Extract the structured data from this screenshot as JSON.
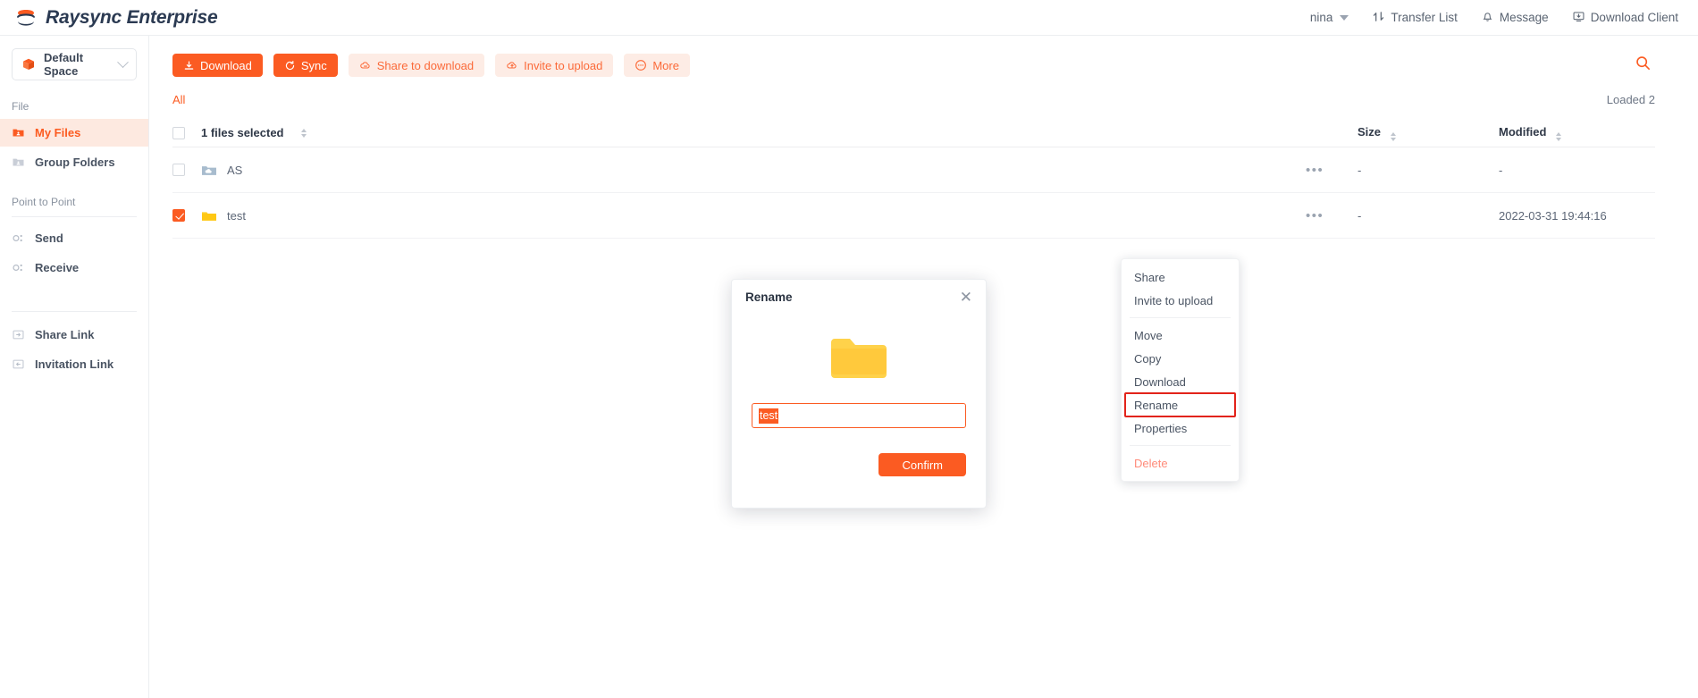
{
  "header": {
    "logo_icon": "raysync-stack-icon",
    "brand": "Raysync Enterprise",
    "user": "nina",
    "transfer_list": "Transfer List",
    "message": "Message",
    "download_client": "Download Client",
    "accent": "#fb5b22"
  },
  "sidebar": {
    "space": {
      "label": "Default Space",
      "icon": "box-icon"
    },
    "sections": [
      {
        "title": "File",
        "items": [
          {
            "label": "My Files",
            "icon": "folder-user-icon",
            "active": true
          },
          {
            "label": "Group Folders",
            "icon": "folder-group-icon",
            "active": false
          }
        ]
      },
      {
        "title": "Point to Point",
        "items": [
          {
            "label": "Send",
            "icon": "send-node-icon",
            "active": false
          },
          {
            "label": "Receive",
            "icon": "receive-node-icon",
            "active": false
          }
        ]
      },
      {
        "title": "",
        "items": [
          {
            "label": "Share Link",
            "icon": "share-link-icon",
            "active": false
          },
          {
            "label": "Invitation Link",
            "icon": "invitation-link-icon",
            "active": false
          }
        ]
      }
    ]
  },
  "toolbar": {
    "buttons": [
      {
        "label": "Download",
        "icon": "download-icon",
        "style": "solid"
      },
      {
        "label": "Sync",
        "icon": "sync-icon",
        "style": "solid"
      },
      {
        "label": "Share to download",
        "icon": "cloud-share-icon",
        "style": "soft"
      },
      {
        "label": "Invite to upload",
        "icon": "cloud-upload-icon",
        "style": "soft"
      },
      {
        "label": "More",
        "icon": "more-circle-icon",
        "style": "soft"
      }
    ],
    "search_icon": "search-icon"
  },
  "breadcrumb": {
    "all": "All",
    "loaded": "Loaded 2"
  },
  "table": {
    "headers": {
      "name": "1 files selected",
      "size": "Size",
      "modified": "Modified"
    },
    "rows": [
      {
        "name": "AS",
        "icon": "cloud-folder-icon",
        "checked": false,
        "dots": "•••",
        "size": "-",
        "modified": "-"
      },
      {
        "name": "test",
        "icon": "yellow-folder-icon",
        "checked": true,
        "dots": "•••",
        "size": "-",
        "modified": "2022-03-31 19:44:16"
      }
    ]
  },
  "context_menu": {
    "items": [
      {
        "label": "Share",
        "kind": "normal"
      },
      {
        "label": "Invite to upload",
        "kind": "normal"
      },
      {
        "label": "__sep__",
        "kind": "sep"
      },
      {
        "label": "Move",
        "kind": "normal"
      },
      {
        "label": "Copy",
        "kind": "normal"
      },
      {
        "label": "Download",
        "kind": "normal"
      },
      {
        "label": "Rename",
        "kind": "highlight"
      },
      {
        "label": "Properties",
        "kind": "normal"
      },
      {
        "label": "__sep__",
        "kind": "sep"
      },
      {
        "label": "Delete",
        "kind": "danger"
      }
    ],
    "highlight_color": "#e2231a"
  },
  "modal": {
    "title": "Rename",
    "close_icon": "close-icon",
    "folder_icon": "yellow-folder-large-icon",
    "input_value": "test",
    "input_placeholder": "",
    "confirm": "Confirm"
  }
}
